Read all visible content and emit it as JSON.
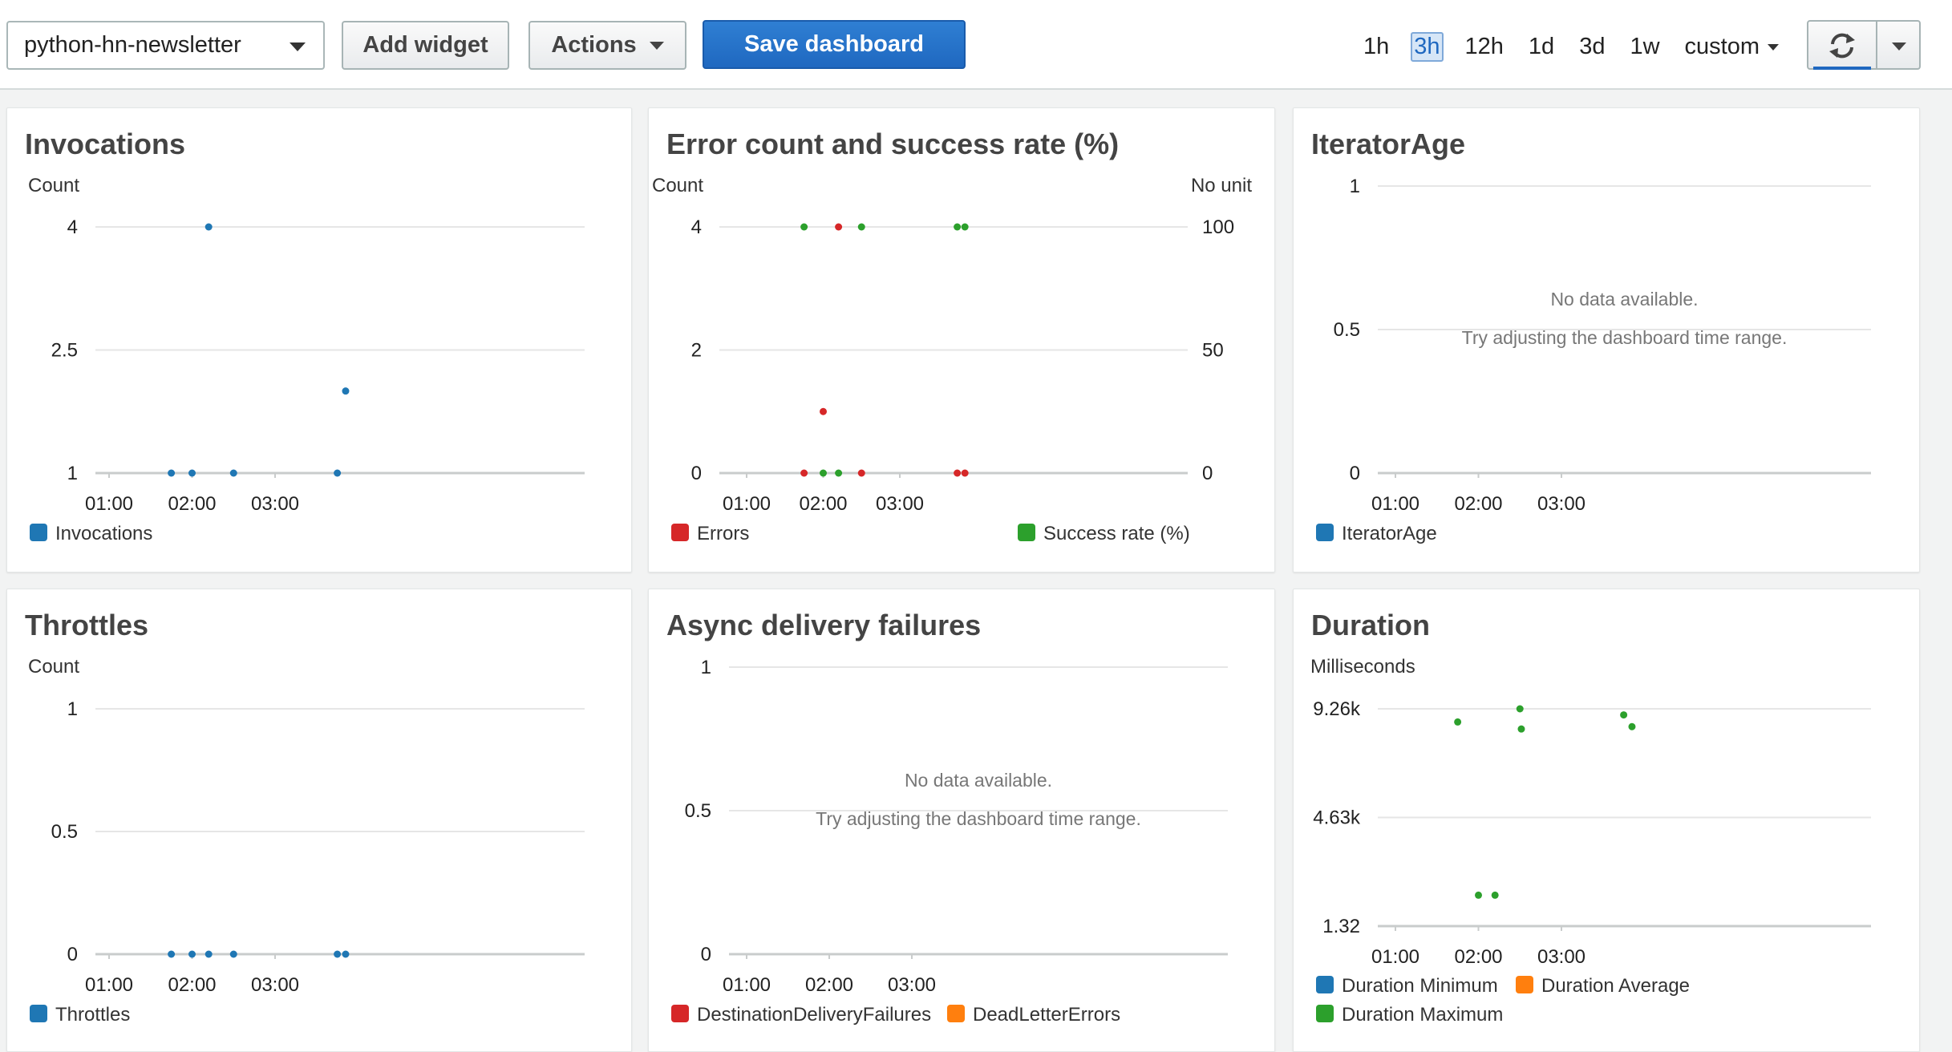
{
  "toolbar": {
    "dashboard_name": "python-hn-newsletter",
    "add_widget_label": "Add widget",
    "actions_label": "Actions",
    "save_label": "Save dashboard",
    "time_ranges": [
      "1h",
      "3h",
      "12h",
      "1d",
      "3d",
      "1w"
    ],
    "active_time_range": "3h",
    "custom_label": "custom",
    "accent_color": "#1f68c0"
  },
  "icons": {
    "refresh": "refresh-icon",
    "dropdown": "chevron-down-icon"
  },
  "colors": {
    "blue": "#1f77b4",
    "red": "#d62728",
    "green": "#2ca02c",
    "orange": "#ff7f0e"
  },
  "widgets": [
    {
      "id": "invocations",
      "title": "Invocations",
      "unit_left": "Count",
      "legend": [
        {
          "label": "Invocations",
          "color": "#1f77b4"
        }
      ],
      "chart_data": {
        "type": "scatter",
        "x_ticks": [
          "01:00",
          "02:00",
          "03:00"
        ],
        "y_ticks": [
          "1",
          "2.5",
          "4"
        ],
        "series": [
          {
            "name": "Invocations",
            "color": "#1f77b4",
            "points": [
              [
                "01:45",
                1
              ],
              [
                "02:00",
                1
              ],
              [
                "02:12",
                4
              ],
              [
                "02:30",
                1
              ],
              [
                "03:45",
                1
              ],
              [
                "03:51",
                2
              ]
            ]
          }
        ]
      }
    },
    {
      "id": "errors",
      "title": "Error count and success rate (%)",
      "unit_left": "Count",
      "unit_right": "No unit",
      "legend": [
        {
          "label": "Errors",
          "color": "#d62728"
        },
        {
          "label": "Success rate (%)",
          "color": "#2ca02c"
        }
      ],
      "chart_data": {
        "type": "scatter",
        "x_ticks": [
          "01:00",
          "02:00",
          "03:00"
        ],
        "y_ticks": [
          "0",
          "2",
          "4"
        ],
        "y2_ticks": [
          "0",
          "50",
          "100"
        ],
        "series": [
          {
            "name": "Errors",
            "color": "#d62728",
            "points": [
              [
                "01:45",
                0
              ],
              [
                "02:00",
                1
              ],
              [
                "02:12",
                4
              ],
              [
                "02:30",
                0
              ],
              [
                "03:45",
                0
              ],
              [
                "03:51",
                0
              ]
            ]
          },
          {
            "name": "Success rate (%)",
            "color": "#2ca02c",
            "axis": "right",
            "points": [
              [
                "01:45",
                100
              ],
              [
                "02:00",
                0
              ],
              [
                "02:12",
                0
              ],
              [
                "02:30",
                100
              ],
              [
                "03:45",
                100
              ],
              [
                "03:51",
                100
              ]
            ]
          }
        ]
      }
    },
    {
      "id": "iterator-age",
      "title": "IteratorAge",
      "no_data": "No data available.",
      "no_data_hint": "Try adjusting the dashboard time range.",
      "legend": [
        {
          "label": "IteratorAge",
          "color": "#1f77b4"
        }
      ],
      "chart_data": {
        "type": "scatter",
        "x_ticks": [
          "01:00",
          "02:00",
          "03:00"
        ],
        "y_ticks": [
          "0",
          "0.5",
          "1"
        ],
        "series": []
      }
    },
    {
      "id": "throttles",
      "title": "Throttles",
      "unit_left": "Count",
      "legend": [
        {
          "label": "Throttles",
          "color": "#1f77b4"
        }
      ],
      "chart_data": {
        "type": "scatter",
        "x_ticks": [
          "01:00",
          "02:00",
          "03:00"
        ],
        "y_ticks": [
          "0",
          "0.5",
          "1"
        ],
        "series": [
          {
            "name": "Throttles",
            "color": "#1f77b4",
            "points": [
              [
                "01:45",
                0
              ],
              [
                "02:00",
                0
              ],
              [
                "02:12",
                0
              ],
              [
                "02:30",
                0
              ],
              [
                "03:45",
                0
              ],
              [
                "03:51",
                0
              ]
            ]
          }
        ]
      }
    },
    {
      "id": "async-failures",
      "title": "Async delivery failures",
      "no_data": "No data available.",
      "no_data_hint": "Try adjusting the dashboard time range.",
      "legend": [
        {
          "label": "DestinationDeliveryFailures",
          "color": "#d62728"
        },
        {
          "label": "DeadLetterErrors",
          "color": "#ff7f0e"
        }
      ],
      "chart_data": {
        "type": "scatter",
        "x_ticks": [
          "01:00",
          "02:00",
          "03:00"
        ],
        "y_ticks": [
          "0",
          "0.5",
          "1"
        ],
        "series": []
      }
    },
    {
      "id": "duration",
      "title": "Duration",
      "unit_left": "Milliseconds",
      "legend": [
        {
          "label": "Duration Minimum",
          "color": "#1f77b4"
        },
        {
          "label": "Duration Average",
          "color": "#ff7f0e"
        },
        {
          "label": "Duration Maximum",
          "color": "#2ca02c"
        }
      ],
      "chart_data": {
        "type": "scatter",
        "x_ticks": [
          "01:00",
          "02:00",
          "03:00"
        ],
        "y_ticks": [
          "1.32",
          "4.63k",
          "9.26k"
        ],
        "series": [
          {
            "name": "Duration Maximum",
            "color": "#2ca02c",
            "points": [
              [
                "01:45",
                8700
              ],
              [
                "02:00",
                1320
              ],
              [
                "02:12",
                1320
              ],
              [
                "02:30",
                9260
              ],
              [
                "02:31",
                8400
              ],
              [
                "03:45",
                9000
              ],
              [
                "03:51",
                8500
              ]
            ]
          }
        ]
      }
    }
  ]
}
